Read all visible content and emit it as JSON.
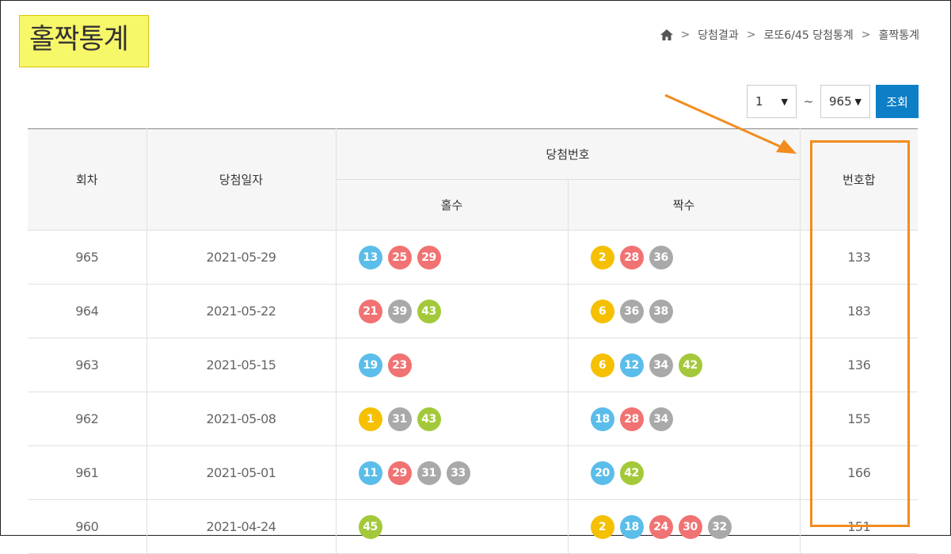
{
  "page": {
    "title": "홀짝통계"
  },
  "breadcrumb": {
    "items": [
      "당첨결과",
      "로또6/45 당첨통계",
      "홀짝통계"
    ]
  },
  "filter": {
    "from": "1",
    "to": "965",
    "query_label": "조회",
    "tilde": "~"
  },
  "table": {
    "headers": {
      "round": "회차",
      "date": "당첨일자",
      "winning_numbers": "당첨번호",
      "odd": "홀수",
      "even": "짝수",
      "sum": "번호합"
    },
    "rows": [
      {
        "round": "965",
        "date": "2021-05-29",
        "odd": [
          13,
          25,
          29
        ],
        "even": [
          2,
          28,
          36
        ],
        "sum": "133"
      },
      {
        "round": "964",
        "date": "2021-05-22",
        "odd": [
          21,
          39,
          43
        ],
        "even": [
          6,
          36,
          38
        ],
        "sum": "183"
      },
      {
        "round": "963",
        "date": "2021-05-15",
        "odd": [
          19,
          23
        ],
        "even": [
          6,
          12,
          34,
          42
        ],
        "sum": "136"
      },
      {
        "round": "962",
        "date": "2021-05-08",
        "odd": [
          1,
          31,
          43
        ],
        "even": [
          18,
          28,
          34
        ],
        "sum": "155"
      },
      {
        "round": "961",
        "date": "2021-05-01",
        "odd": [
          11,
          29,
          31,
          33
        ],
        "even": [
          20,
          42
        ],
        "sum": "166"
      },
      {
        "round": "960",
        "date": "2021-04-24",
        "odd": [
          45
        ],
        "even": [
          2,
          18,
          24,
          30,
          32
        ],
        "sum": "151"
      }
    ]
  },
  "ball_colors": {
    "1-10": "#f4c000",
    "11-20": "#5bbde9",
    "21-30": "#f17272",
    "31-40": "#a9a9a9",
    "41-45": "#a3c93a"
  },
  "annotation": {
    "color": "#f28c1e"
  }
}
